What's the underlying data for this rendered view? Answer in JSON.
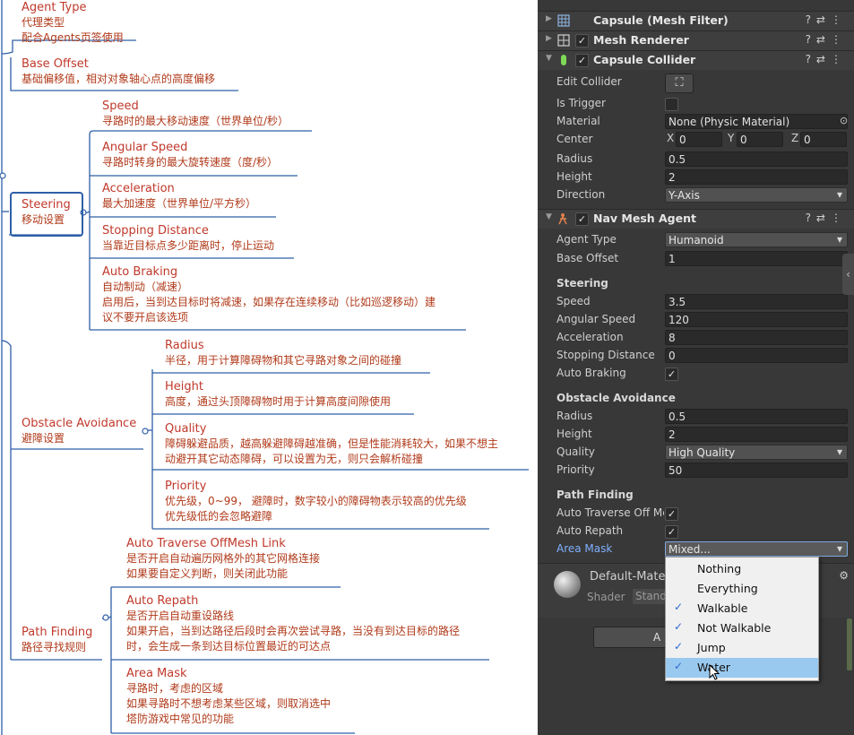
{
  "mindmap": {
    "agent_type": {
      "title": "Agent Type",
      "lines": [
        "代理类型",
        "配合Agents页签使用"
      ]
    },
    "base_offset": {
      "title": "Base Offset",
      "lines": [
        "基础偏移值，相对对象轴心点的高度偏移"
      ]
    },
    "steering": {
      "title": "Steering",
      "lines": [
        "移动设置"
      ]
    },
    "speed": {
      "title": "Speed",
      "lines": [
        "寻路时的最大移动速度（世界单位/秒）"
      ]
    },
    "angular_speed": {
      "title": "Angular Speed",
      "lines": [
        "寻路时转身的最大旋转速度（度/秒）"
      ]
    },
    "acceleration": {
      "title": "Acceleration",
      "lines": [
        "最大加速度（世界单位/平方秒）"
      ]
    },
    "stopping_distance": {
      "title": "Stopping Distance",
      "lines": [
        "当靠近目标点多少距离时，停止运动"
      ]
    },
    "auto_braking": {
      "title": "Auto Braking",
      "lines": [
        "自动制动（减速）",
        "启用后，当到达目标时将减速，如果存在连续移动（比如巡逻移动）建",
        "议不要开启该选项"
      ]
    },
    "obstacle": {
      "title": "Obstacle Avoidance",
      "lines": [
        "避障设置"
      ]
    },
    "radius": {
      "title": "Radius",
      "lines": [
        "半径，用于计算障碍物和其它寻路对象之间的碰撞"
      ]
    },
    "height": {
      "title": "Height",
      "lines": [
        "高度，通过头顶障碍物时用于计算高度间隙使用"
      ]
    },
    "quality": {
      "title": "Quality",
      "lines": [
        "障碍躲避品质，越高躲避障碍越准确，但是性能消耗较大，如果不想主",
        "动避开其它动态障碍，可以设置为无，则只会解析碰撞"
      ]
    },
    "priority": {
      "title": "Priority",
      "lines": [
        "优先级，0~99， 避障时，数字较小的障碍物表示较高的优先级",
        "优先级低的会忽略避障"
      ]
    },
    "path_finding": {
      "title": "Path Finding",
      "lines": [
        "路径寻找规则"
      ]
    },
    "auto_traverse": {
      "title": "Auto Traverse OffMesh Link",
      "lines": [
        "是否开启自动遍历网格外的其它网格连接",
        "如果要自定义判断，则关闭此功能"
      ]
    },
    "auto_repath": {
      "title": "Auto Repath",
      "lines": [
        "是否开启自动重设路线",
        "如果开启，当到达路径后段时会再次尝试寻路，当没有到达目标的路径",
        "时，会生成一条到达目标位置最近的可达点"
      ]
    },
    "area_mask": {
      "title": "Area Mask",
      "lines": [
        "寻路时，考虑的区域",
        "如果寻路时不想考虑某些区域，则取消选中",
        "塔防游戏中常见的功能"
      ]
    }
  },
  "inspector": {
    "components": {
      "mesh_filter": "Capsule (Mesh Filter)",
      "mesh_renderer": "Mesh Renderer",
      "capsule_collider": "Capsule Collider",
      "nav_mesh_agent": "Nav Mesh Agent"
    },
    "collider": {
      "edit_collider": "Edit Collider",
      "is_trigger": "Is Trigger",
      "material_label": "Material",
      "material_value": "None (Physic Material)",
      "center_label": "Center",
      "center_x": "0",
      "center_y": "0",
      "center_z": "0",
      "radius_label": "Radius",
      "radius_value": "0.5",
      "height_label": "Height",
      "height_value": "2",
      "direction_label": "Direction",
      "direction_value": "Y-Axis"
    },
    "agent": {
      "agent_type_label": "Agent Type",
      "agent_type_value": "Humanoid",
      "base_offset_label": "Base Offset",
      "base_offset_value": "1",
      "steering_header": "Steering",
      "speed_label": "Speed",
      "speed_value": "3.5",
      "angular_label": "Angular Speed",
      "angular_value": "120",
      "accel_label": "Acceleration",
      "accel_value": "8",
      "stopping_label": "Stopping Distance",
      "stopping_value": "0",
      "braking_label": "Auto Braking",
      "obstacle_header": "Obstacle Avoidance",
      "radius_label": "Radius",
      "radius_value": "0.5",
      "height_label": "Height",
      "height_value": "2",
      "quality_label": "Quality",
      "quality_value": "High Quality",
      "priority_label": "Priority",
      "priority_value": "50",
      "path_header": "Path Finding",
      "traverse_label": "Auto Traverse Off Me",
      "repath_label": "Auto Repath",
      "area_label": "Area Mask",
      "area_value": "Mixed..."
    },
    "material": {
      "name": "Default-Mate",
      "shader_label": "Shader",
      "shader_value": "Stand"
    },
    "add_button": "A",
    "popup": {
      "items": [
        {
          "label": "Nothing",
          "checked": false
        },
        {
          "label": "Everything",
          "checked": false
        },
        {
          "label": "Walkable",
          "checked": true
        },
        {
          "label": "Not Walkable",
          "checked": true
        },
        {
          "label": "Jump",
          "checked": true
        },
        {
          "label": "Water",
          "checked": true
        }
      ],
      "checkmark": "✓"
    },
    "colors": {
      "panel": "#383838",
      "accent_label": "#7fb0ff",
      "popup_selected": "#99c9ef",
      "mindmap_text": "#c0392b",
      "mindmap_lines": "#2f5fa8"
    }
  }
}
